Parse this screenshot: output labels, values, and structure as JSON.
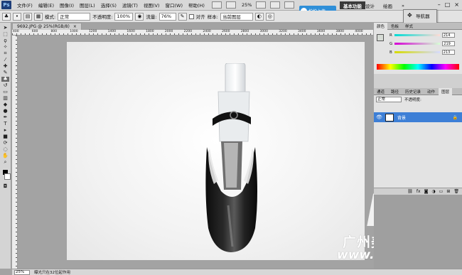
{
  "app": {
    "logo": "Ps"
  },
  "menubar": {
    "items": [
      "文件(F)",
      "编辑(E)",
      "图像(I)",
      "图层(L)",
      "选择(S)",
      "滤镜(T)",
      "视图(V)",
      "窗口(W)",
      "帮助(H)"
    ],
    "zoom": "25%",
    "workspaces": [
      "基本功能",
      "设计",
      "绘画",
      "»"
    ]
  },
  "options": {
    "mode_label": "模式:",
    "mode_value": "正常",
    "opacity_label": "不透明度:",
    "opacity_value": "100%",
    "flow_label": "流量:",
    "flow_value": "76%",
    "aligned_label": "对齐",
    "sample_label": "样本:",
    "sample_value": "当前图层"
  },
  "cloud": {
    "label": "拍拍上传"
  },
  "dropdown": {
    "items": [
      "导航器",
      "样式"
    ]
  },
  "document": {
    "tab_title": "9692.JPG @ 25%(RGB/8)",
    "close": "×"
  },
  "rulers": {
    "h_labels": [
      "400",
      "600",
      "800",
      "1000",
      "1200",
      "1400",
      "1600",
      "1800",
      "2000",
      "2200",
      "2400",
      "2600",
      "2800",
      "3000",
      "3200",
      "3400",
      "3600",
      "3800",
      "4000"
    ]
  },
  "status": {
    "zoom": "25%",
    "info": "曝光只在32位起作用"
  },
  "panels": {
    "color_tabs": [
      "颜色",
      "色板",
      "样式"
    ],
    "rgb": [
      {
        "ch": "R",
        "value": "214"
      },
      {
        "ch": "G",
        "value": "219"
      },
      {
        "ch": "B",
        "value": "213"
      }
    ],
    "layer_tabs": [
      "通道",
      "路径",
      "历史记录",
      "动作",
      "图层"
    ],
    "blend_mode": "正常",
    "opacity_label": "不透明度:",
    "layer_name": "背景"
  },
  "watermark": {
    "logo": "MD",
    "cn": "广州美迪电商学院",
    "url": "www.MeDe.com.cn"
  },
  "colors": {
    "accent": "#3d7fd6",
    "cloud": "#2f8fd8"
  }
}
